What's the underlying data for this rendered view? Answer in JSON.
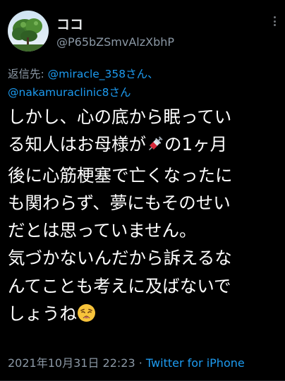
{
  "tweet": {
    "display_name": "ココ",
    "handle": "@P65bZSmvAlzXbhP",
    "reply_prefix": "返信先: ",
    "reply_user_1": "@miracle_358",
    "reply_suffix_1": "さん、",
    "reply_user_2": "@nakamuraclinic8",
    "reply_suffix_2": "さん",
    "lines": {
      "l1": "しかし、心の底から眠ってい",
      "l2a": "る知人はお母様が",
      "l2b": "の1ヶ月",
      "l3": "後に心筋梗塞で亡くなったに",
      "l4": "も関わらず、夢にもそのせい",
      "l5": "だとは思っていません。",
      "l6": "気づかないんだから訴えるな",
      "l7": "んてことも考えに及ばないで",
      "l8": "しょうね"
    },
    "timestamp": "2021年10月31日 22:23",
    "separator": " · ",
    "source": "Twitter for iPhone"
  },
  "icons": {
    "avatar": "avatar-tree-photo",
    "more": "more-options-icon",
    "syringe": "syringe-emoji",
    "weary": "weary-face-emoji"
  },
  "colors": {
    "background": "#000000",
    "text": "#ffffff",
    "secondary": "#8b98a5",
    "link": "#1d9bf0"
  }
}
